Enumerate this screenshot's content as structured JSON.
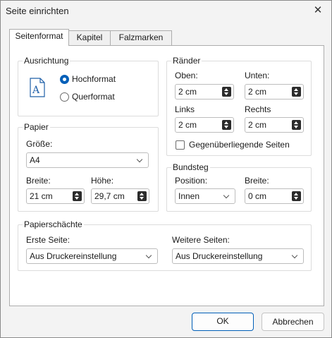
{
  "window": {
    "title": "Seite einrichten",
    "close_glyph": "✕"
  },
  "tabs": [
    "Seitenformat",
    "Kapitel",
    "Falzmarken"
  ],
  "orientation": {
    "title": "Ausrichtung",
    "icon": "page-portrait-icon",
    "icon_letter": "A",
    "portrait_label": "Hochformat",
    "landscape_label": "Querformat",
    "selected": "Hochformat"
  },
  "margins": {
    "title": "Ränder",
    "top_label": "Oben:",
    "top_value": "2 cm",
    "bottom_label": "Unten:",
    "bottom_value": "2 cm",
    "left_label": "Links",
    "left_value": "2 cm",
    "right_label": "Rechts",
    "right_value": "2 cm",
    "mirror_label": "Gegenüberliegende Seiten",
    "mirror_checked": false
  },
  "paper": {
    "title": "Papier",
    "size_label": "Größe:",
    "size_value": "A4",
    "width_label": "Breite:",
    "width_value": "21 cm",
    "height_label": "Höhe:",
    "height_value": "29,7 cm"
  },
  "gutter": {
    "title": "Bundsteg",
    "position_label": "Position:",
    "position_value": "Innen",
    "width_label": "Breite:",
    "width_value": "0 cm"
  },
  "trays": {
    "title": "Papierschächte",
    "first_label": "Erste Seite:",
    "first_value": "Aus Druckereinstellung",
    "other_label": "Weitere Seiten:",
    "other_value": "Aus Druckereinstellung"
  },
  "buttons": {
    "ok": "OK",
    "cancel": "Abbrechen"
  },
  "colors": {
    "accent": "#005fb8",
    "icon_blue": "#1f5fa8"
  }
}
